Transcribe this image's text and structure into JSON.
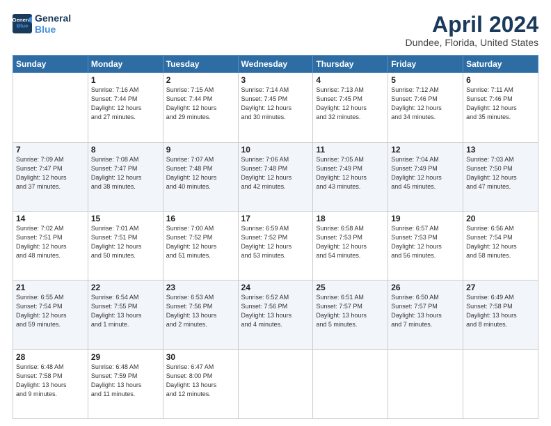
{
  "logo": {
    "line1": "General",
    "line2": "Blue"
  },
  "title": "April 2024",
  "subtitle": "Dundee, Florida, United States",
  "days_of_week": [
    "Sunday",
    "Monday",
    "Tuesday",
    "Wednesday",
    "Thursday",
    "Friday",
    "Saturday"
  ],
  "weeks": [
    [
      {
        "day": "",
        "info": ""
      },
      {
        "day": "1",
        "info": "Sunrise: 7:16 AM\nSunset: 7:44 PM\nDaylight: 12 hours\nand 27 minutes."
      },
      {
        "day": "2",
        "info": "Sunrise: 7:15 AM\nSunset: 7:44 PM\nDaylight: 12 hours\nand 29 minutes."
      },
      {
        "day": "3",
        "info": "Sunrise: 7:14 AM\nSunset: 7:45 PM\nDaylight: 12 hours\nand 30 minutes."
      },
      {
        "day": "4",
        "info": "Sunrise: 7:13 AM\nSunset: 7:45 PM\nDaylight: 12 hours\nand 32 minutes."
      },
      {
        "day": "5",
        "info": "Sunrise: 7:12 AM\nSunset: 7:46 PM\nDaylight: 12 hours\nand 34 minutes."
      },
      {
        "day": "6",
        "info": "Sunrise: 7:11 AM\nSunset: 7:46 PM\nDaylight: 12 hours\nand 35 minutes."
      }
    ],
    [
      {
        "day": "7",
        "info": "Sunrise: 7:09 AM\nSunset: 7:47 PM\nDaylight: 12 hours\nand 37 minutes."
      },
      {
        "day": "8",
        "info": "Sunrise: 7:08 AM\nSunset: 7:47 PM\nDaylight: 12 hours\nand 38 minutes."
      },
      {
        "day": "9",
        "info": "Sunrise: 7:07 AM\nSunset: 7:48 PM\nDaylight: 12 hours\nand 40 minutes."
      },
      {
        "day": "10",
        "info": "Sunrise: 7:06 AM\nSunset: 7:48 PM\nDaylight: 12 hours\nand 42 minutes."
      },
      {
        "day": "11",
        "info": "Sunrise: 7:05 AM\nSunset: 7:49 PM\nDaylight: 12 hours\nand 43 minutes."
      },
      {
        "day": "12",
        "info": "Sunrise: 7:04 AM\nSunset: 7:49 PM\nDaylight: 12 hours\nand 45 minutes."
      },
      {
        "day": "13",
        "info": "Sunrise: 7:03 AM\nSunset: 7:50 PM\nDaylight: 12 hours\nand 47 minutes."
      }
    ],
    [
      {
        "day": "14",
        "info": "Sunrise: 7:02 AM\nSunset: 7:51 PM\nDaylight: 12 hours\nand 48 minutes."
      },
      {
        "day": "15",
        "info": "Sunrise: 7:01 AM\nSunset: 7:51 PM\nDaylight: 12 hours\nand 50 minutes."
      },
      {
        "day": "16",
        "info": "Sunrise: 7:00 AM\nSunset: 7:52 PM\nDaylight: 12 hours\nand 51 minutes."
      },
      {
        "day": "17",
        "info": "Sunrise: 6:59 AM\nSunset: 7:52 PM\nDaylight: 12 hours\nand 53 minutes."
      },
      {
        "day": "18",
        "info": "Sunrise: 6:58 AM\nSunset: 7:53 PM\nDaylight: 12 hours\nand 54 minutes."
      },
      {
        "day": "19",
        "info": "Sunrise: 6:57 AM\nSunset: 7:53 PM\nDaylight: 12 hours\nand 56 minutes."
      },
      {
        "day": "20",
        "info": "Sunrise: 6:56 AM\nSunset: 7:54 PM\nDaylight: 12 hours\nand 58 minutes."
      }
    ],
    [
      {
        "day": "21",
        "info": "Sunrise: 6:55 AM\nSunset: 7:54 PM\nDaylight: 12 hours\nand 59 minutes."
      },
      {
        "day": "22",
        "info": "Sunrise: 6:54 AM\nSunset: 7:55 PM\nDaylight: 13 hours\nand 1 minute."
      },
      {
        "day": "23",
        "info": "Sunrise: 6:53 AM\nSunset: 7:56 PM\nDaylight: 13 hours\nand 2 minutes."
      },
      {
        "day": "24",
        "info": "Sunrise: 6:52 AM\nSunset: 7:56 PM\nDaylight: 13 hours\nand 4 minutes."
      },
      {
        "day": "25",
        "info": "Sunrise: 6:51 AM\nSunset: 7:57 PM\nDaylight: 13 hours\nand 5 minutes."
      },
      {
        "day": "26",
        "info": "Sunrise: 6:50 AM\nSunset: 7:57 PM\nDaylight: 13 hours\nand 7 minutes."
      },
      {
        "day": "27",
        "info": "Sunrise: 6:49 AM\nSunset: 7:58 PM\nDaylight: 13 hours\nand 8 minutes."
      }
    ],
    [
      {
        "day": "28",
        "info": "Sunrise: 6:48 AM\nSunset: 7:58 PM\nDaylight: 13 hours\nand 9 minutes."
      },
      {
        "day": "29",
        "info": "Sunrise: 6:48 AM\nSunset: 7:59 PM\nDaylight: 13 hours\nand 11 minutes."
      },
      {
        "day": "30",
        "info": "Sunrise: 6:47 AM\nSunset: 8:00 PM\nDaylight: 13 hours\nand 12 minutes."
      },
      {
        "day": "",
        "info": ""
      },
      {
        "day": "",
        "info": ""
      },
      {
        "day": "",
        "info": ""
      },
      {
        "day": "",
        "info": ""
      }
    ]
  ]
}
